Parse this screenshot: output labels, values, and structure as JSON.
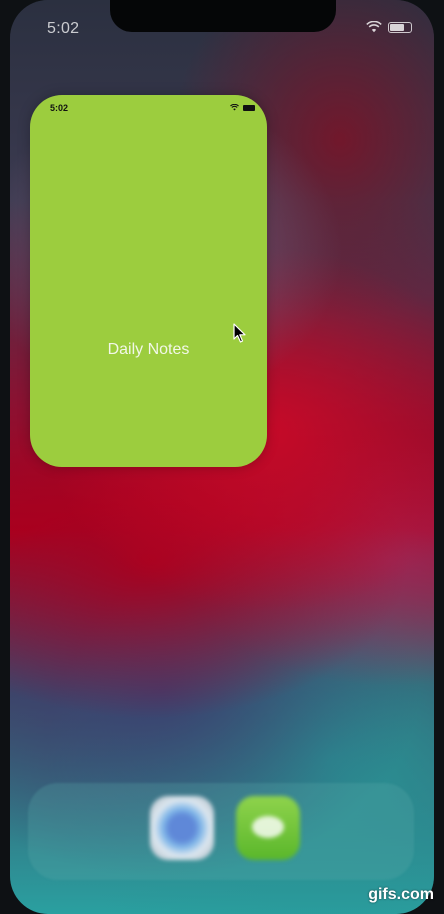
{
  "status_bar": {
    "time": "5:02",
    "icons": [
      "wifi-icon",
      "battery-icon"
    ]
  },
  "app_card": {
    "status_time": "5:02",
    "title": "Daily Notes",
    "background_color": "#9ccd3e",
    "status_icons": [
      "wifi-icon",
      "battery-icon"
    ]
  },
  "dock": {
    "apps": [
      {
        "name": "safari-icon"
      },
      {
        "name": "messages-icon"
      }
    ]
  },
  "watermark": "gifs.com"
}
